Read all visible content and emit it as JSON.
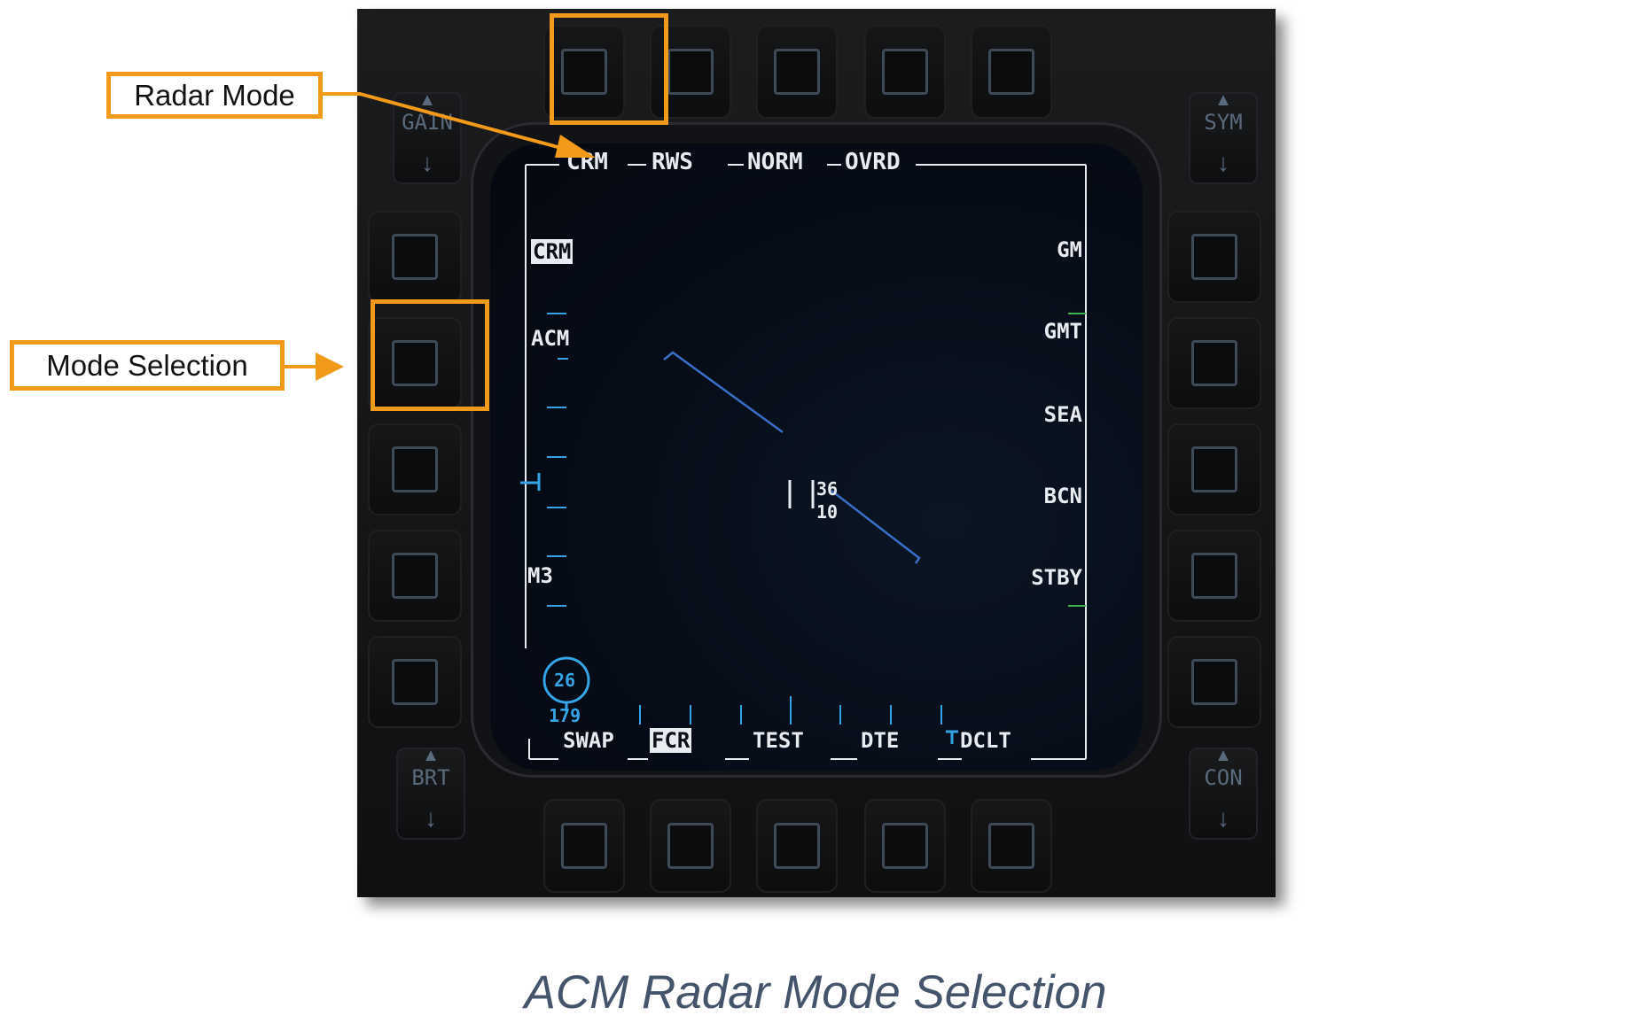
{
  "callouts": {
    "radar_mode": "Radar Mode",
    "mode_selection": "Mode Selection"
  },
  "caption": "ACM Radar Mode Selection",
  "rockers": {
    "gain": "GAIN",
    "sym": "SYM",
    "brt": "BRT",
    "con": "CON"
  },
  "display": {
    "top_labels": [
      "CRM",
      "RWS",
      "NORM",
      "OVRD"
    ],
    "left_labels": {
      "crm": "CRM",
      "acm": "ACM",
      "m3": "M3"
    },
    "right_labels": [
      "GM",
      "GMT",
      "SEA",
      "BCN",
      "STBY"
    ],
    "bottom_labels": [
      "SWAP",
      "FCR",
      "TEST",
      "DTE",
      "DCLT"
    ],
    "cursor_readout": {
      "upper": "36",
      "lower": "10"
    },
    "bullseye": {
      "bearing": "26",
      "range": "179"
    }
  },
  "colors": {
    "callout_border": "#f39a1b",
    "mfd_text": "#e8ecf0",
    "mfd_cyan": "#35a4e6",
    "mfd_green": "#3fb34a",
    "caption": "#44546a"
  }
}
